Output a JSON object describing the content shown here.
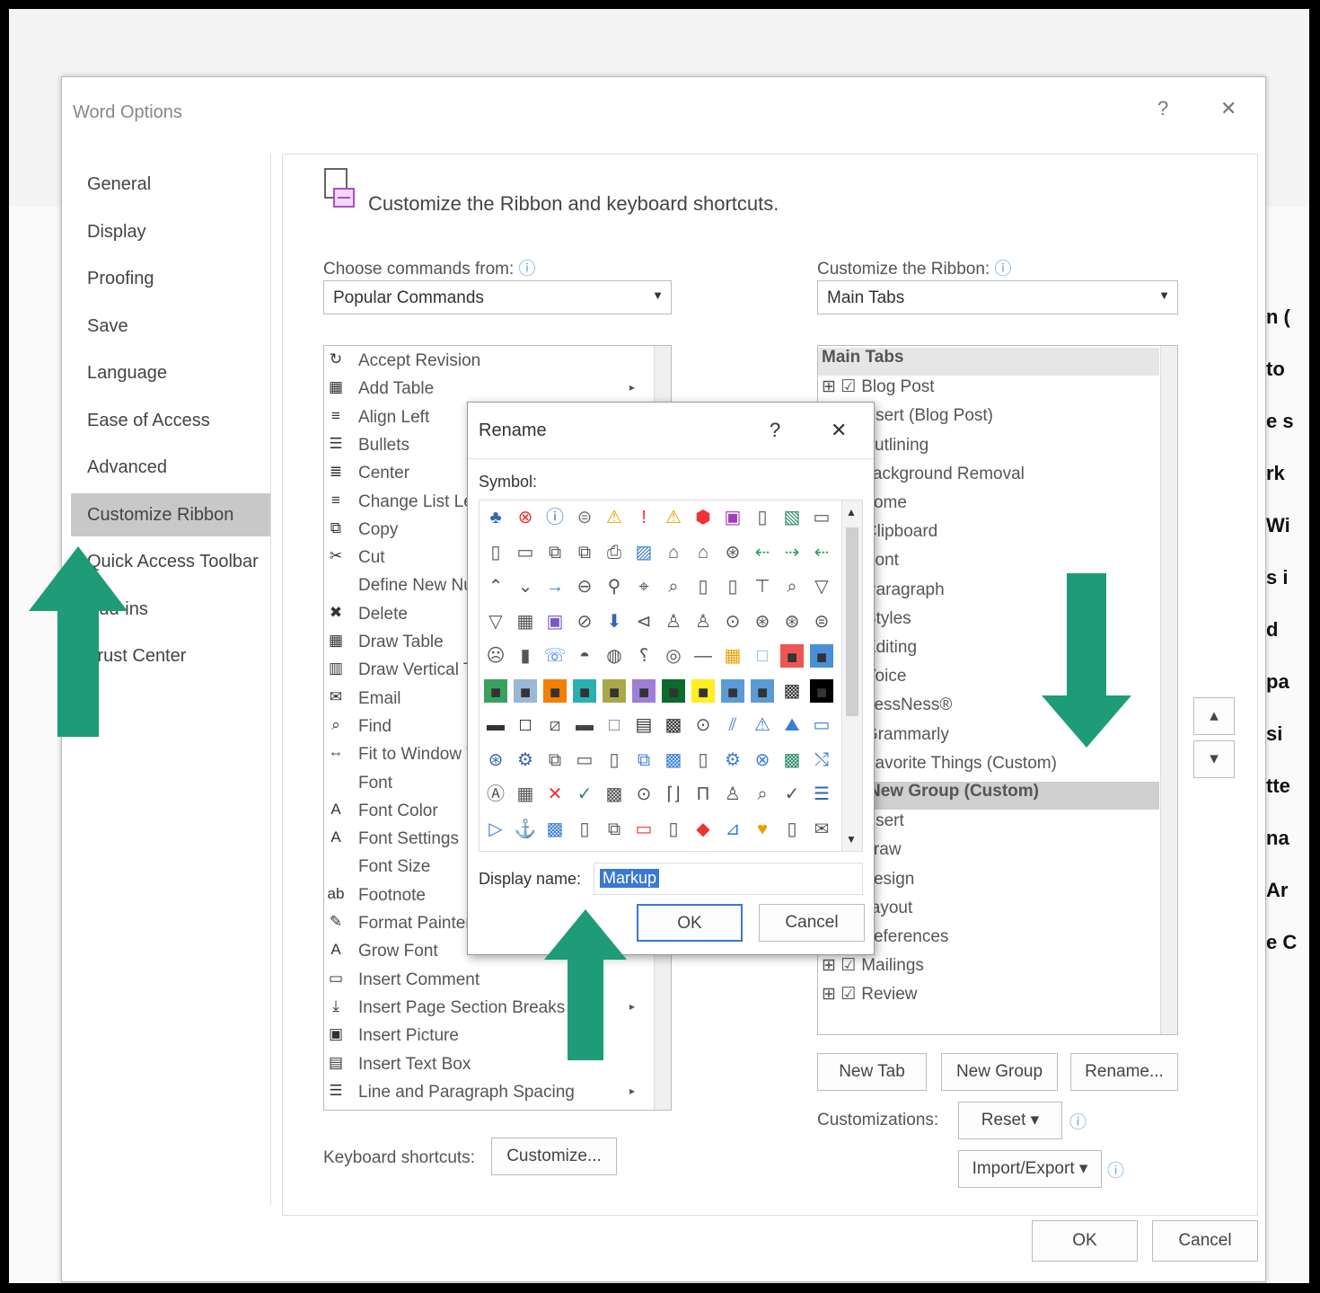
{
  "window": {
    "title": "Word Options",
    "help_glyph": "?",
    "close_glyph": "✕"
  },
  "nav": {
    "items": [
      {
        "label": "General"
      },
      {
        "label": "Display"
      },
      {
        "label": "Proofing"
      },
      {
        "label": "Save"
      },
      {
        "label": "Language"
      },
      {
        "label": "Ease of Access"
      },
      {
        "label": "Advanced"
      },
      {
        "label": "Customize Ribbon",
        "selected": true
      },
      {
        "label": "Quick Access Toolbar"
      },
      {
        "label": "Add-ins"
      },
      {
        "label": "Trust Center"
      }
    ]
  },
  "main": {
    "heading": "Customize the Ribbon and keyboard shortcuts.",
    "choose_label": "Choose commands from:",
    "choose_value": "Popular Commands",
    "ribbon_label": "Customize the Ribbon:",
    "ribbon_value": "Main Tabs",
    "commands": [
      {
        "icon": "↻",
        "label": "Accept Revision"
      },
      {
        "icon": "▦",
        "label": "Add Table",
        "submenu": "▸"
      },
      {
        "icon": "≡",
        "label": "Align Left"
      },
      {
        "icon": "☰",
        "label": "Bullets",
        "submenu": "▸"
      },
      {
        "icon": "≣",
        "label": "Center"
      },
      {
        "icon": "≡",
        "label": "Change List Level",
        "submenu": "▸"
      },
      {
        "icon": "⧉",
        "label": "Copy"
      },
      {
        "icon": "✂",
        "label": "Cut"
      },
      {
        "icon": " ",
        "label": "Define New Number Format..."
      },
      {
        "icon": "✖",
        "label": "Delete"
      },
      {
        "icon": "▦",
        "label": "Draw Table"
      },
      {
        "icon": "▥",
        "label": "Draw Vertical Text Box"
      },
      {
        "icon": "✉",
        "label": "Email"
      },
      {
        "icon": "⌕",
        "label": "Find"
      },
      {
        "icon": "⇔",
        "label": "Fit to Window Width"
      },
      {
        "icon": " ",
        "label": "Font"
      },
      {
        "icon": "A",
        "label": "Font Color",
        "submenu": "▸"
      },
      {
        "icon": "A",
        "label": "Font Settings"
      },
      {
        "icon": " ",
        "label": "Font Size"
      },
      {
        "icon": "ab",
        "label": "Footnote"
      },
      {
        "icon": "✎",
        "label": "Format Painter"
      },
      {
        "icon": "A",
        "label": "Grow Font"
      },
      {
        "icon": "▭",
        "label": "Insert Comment"
      },
      {
        "icon": "⤓",
        "label": "Insert Page  Section Breaks",
        "submenu": "▸"
      },
      {
        "icon": "▣",
        "label": "Insert Picture"
      },
      {
        "icon": "▤",
        "label": "Insert Text Box"
      },
      {
        "icon": "☰",
        "label": "Line and Paragraph Spacing",
        "submenu": "▸"
      }
    ],
    "tree": [
      {
        "label": "Main Tabs",
        "header": true
      },
      {
        "prefix": "⊞ ☑",
        "label": "Blog Post"
      },
      {
        "prefix": "⊞ ☑",
        "label": "Insert (Blog Post)"
      },
      {
        "prefix": "⊞ ☑",
        "label": "Outlining"
      },
      {
        "prefix": "⊞ ☑",
        "label": "Background Removal"
      },
      {
        "prefix": "⊟ ☑",
        "label": "Home"
      },
      {
        "prefix": "⊞",
        "label": "Clipboard",
        "indent": 1
      },
      {
        "prefix": "⊞",
        "label": "Font",
        "indent": 1
      },
      {
        "prefix": "⊞",
        "label": "Paragraph",
        "indent": 1
      },
      {
        "prefix": "⊞",
        "label": "Styles",
        "indent": 1
      },
      {
        "prefix": "⊞",
        "label": "Editing",
        "indent": 1
      },
      {
        "prefix": "⊞",
        "label": "Voice",
        "indent": 1
      },
      {
        "prefix": "⊞",
        "label": "LessNess®",
        "indent": 1
      },
      {
        "prefix": "⊞",
        "label": "Grammarly",
        "indent": 1
      },
      {
        "prefix": "⊟",
        "label": "Favorite Things (Custom)",
        "indent": 1
      },
      {
        "prefix": "",
        "label": "New Group (Custom)",
        "indent": 2,
        "selected": true
      },
      {
        "prefix": "⊞ ☑",
        "label": "Insert"
      },
      {
        "prefix": "⊞ ☑",
        "label": "Draw"
      },
      {
        "prefix": "⊞ ☑",
        "label": "Design"
      },
      {
        "prefix": "⊞ ☑",
        "label": "Layout"
      },
      {
        "prefix": "⊞ ☑",
        "label": "References"
      },
      {
        "prefix": "⊞ ☑",
        "label": "Mailings"
      },
      {
        "prefix": "⊞ ☑",
        "label": "Review"
      }
    ],
    "new_tab": "New Tab",
    "new_group": "New Group",
    "rename": "Rename...",
    "customizations_label": "Customizations:",
    "reset": "Reset ▾",
    "import_export": "Import/Export ▾",
    "keyboard_label": "Keyboard shortcuts:",
    "customize_btn": "Customize...",
    "move_up": "▴",
    "move_down": "▾"
  },
  "footer": {
    "ok": "OK",
    "cancel": "Cancel"
  },
  "rename_dialog": {
    "title": "Rename",
    "help": "?",
    "close": "✕",
    "symbol_label": "Symbol:",
    "display_label": "Display name:",
    "display_value": "Markup",
    "ok": "OK",
    "cancel": "Cancel",
    "symbols": [
      [
        "♣",
        "⊗",
        "ⓘ",
        "⊜",
        "⚠",
        "!",
        "⚠",
        "⬢",
        "▣",
        "▯",
        "▧",
        "▭"
      ],
      [
        "▯",
        "▭",
        "⧉",
        "⧉",
        "⎙",
        "▨",
        "⌂",
        "⌂",
        "⊛",
        "⇠",
        "⇢",
        "⇠"
      ],
      [
        "⌃",
        "⌄",
        "→",
        "⊖",
        "⚲",
        "⌖",
        "⌕",
        "▯",
        "▯",
        "⊤",
        "⌕",
        "▽"
      ],
      [
        "▽",
        "▦",
        "▣",
        "⊘",
        "⬇",
        "⊲",
        "♙",
        "♙",
        "⊙",
        "⊛",
        "⊛",
        "⊜"
      ],
      [
        "☹",
        "▮",
        "☏",
        "◓",
        "◍",
        "⸮",
        "◎",
        "—",
        "▦",
        "□",
        "■",
        "■"
      ],
      [
        "■",
        "■",
        "■",
        "■",
        "■",
        "■",
        "■",
        "■",
        "■",
        "■",
        "▩",
        "■"
      ],
      [
        "▬",
        "□",
        "⧄",
        "▬",
        "□",
        "▤",
        "▩",
        "⊙",
        "⫽",
        "⚠",
        "⛰",
        "▭"
      ],
      [
        "⊛",
        "⚙",
        "⧉",
        "▭",
        "▯",
        "⧉",
        "▩",
        "▯",
        "⚙",
        "⊗",
        "▩",
        "⤭"
      ],
      [
        "Ⓐ",
        "▦",
        "✕",
        "✓",
        "▩",
        "⊙",
        "⌈⌋",
        "Π",
        "♙",
        "⌕",
        "✓",
        "☰"
      ],
      [
        "▷",
        "⚓",
        "▩",
        "▯",
        "⧉",
        "▭",
        "▯",
        "◆",
        "⊿",
        "♥",
        "▯",
        "✉"
      ]
    ],
    "symbol_colors": [
      [
        "#3565b3",
        "#e33",
        "#3a7fd4",
        "#777",
        "#e8a000",
        "#e33",
        "#e8a000",
        "#e33",
        "#a33cb8",
        "#555",
        "#2a8c6a",
        "#555"
      ],
      [
        "#555",
        "#555",
        "#555",
        "#555",
        "#555",
        "#3a7fd4",
        "#555",
        "#555",
        "#555",
        "#29a366",
        "#29a366",
        "#29a366"
      ],
      [
        "#555",
        "#555",
        "#3a7fd4",
        "#555",
        "#555",
        "#555",
        "#555",
        "#555",
        "#555",
        "#555",
        "#555",
        "#555"
      ],
      [
        "#555",
        "#555",
        "#7a5ac0",
        "#555",
        "#3565b3",
        "#555",
        "#555",
        "#555",
        "#555",
        "#555",
        "#555",
        "#555"
      ],
      [
        "#555",
        "#555",
        "#3a7fd4",
        "#555",
        "#555",
        "#555",
        "#555",
        "#555",
        "#e8a000",
        "#8ab6e6",
        "#e55",
        "#4a90d9"
      ],
      [
        "#3aa060",
        "#9ab7d6",
        "#f08000",
        "#2bb0b0",
        "#a8a84a",
        "#9e7fd8",
        "#0b6b2b",
        "#ffee22",
        "#5b9bd5",
        "#5b9bd5",
        "#333",
        "#000"
      ],
      [
        "#333",
        "#000",
        "#555",
        "#444",
        "#777",
        "#333",
        "#333",
        "#555",
        "#3a7fd4",
        "#3a7fd4",
        "#3a7fd4",
        "#3a7fd4"
      ],
      [
        "#3565b3",
        "#3565b3",
        "#555",
        "#555",
        "#555",
        "#3a7fd4",
        "#3a7fd4",
        "#555",
        "#3a7fd4",
        "#3a7fd4",
        "#2a8c6a",
        "#3a7fd4"
      ],
      [
        "#555",
        "#555",
        "#e33",
        "#2a8c6a",
        "#555",
        "#555",
        "#555",
        "#555",
        "#555",
        "#555",
        "#555",
        "#3565b3"
      ],
      [
        "#3a7fd4",
        "#3a7fd4",
        "#3a7fd4",
        "#555",
        "#555",
        "#e33",
        "#555",
        "#e33",
        "#3a7fd4",
        "#e8a000",
        "#555",
        "#555"
      ]
    ]
  },
  "annotations": {
    "arrow_color": "#1e9c78"
  },
  "background_text": [
    "n (",
    "to",
    "e s",
    "rk",
    "Wi",
    "s i",
    "d",
    "pa",
    "si",
    "tte",
    "na",
    "Ar",
    "e C"
  ]
}
